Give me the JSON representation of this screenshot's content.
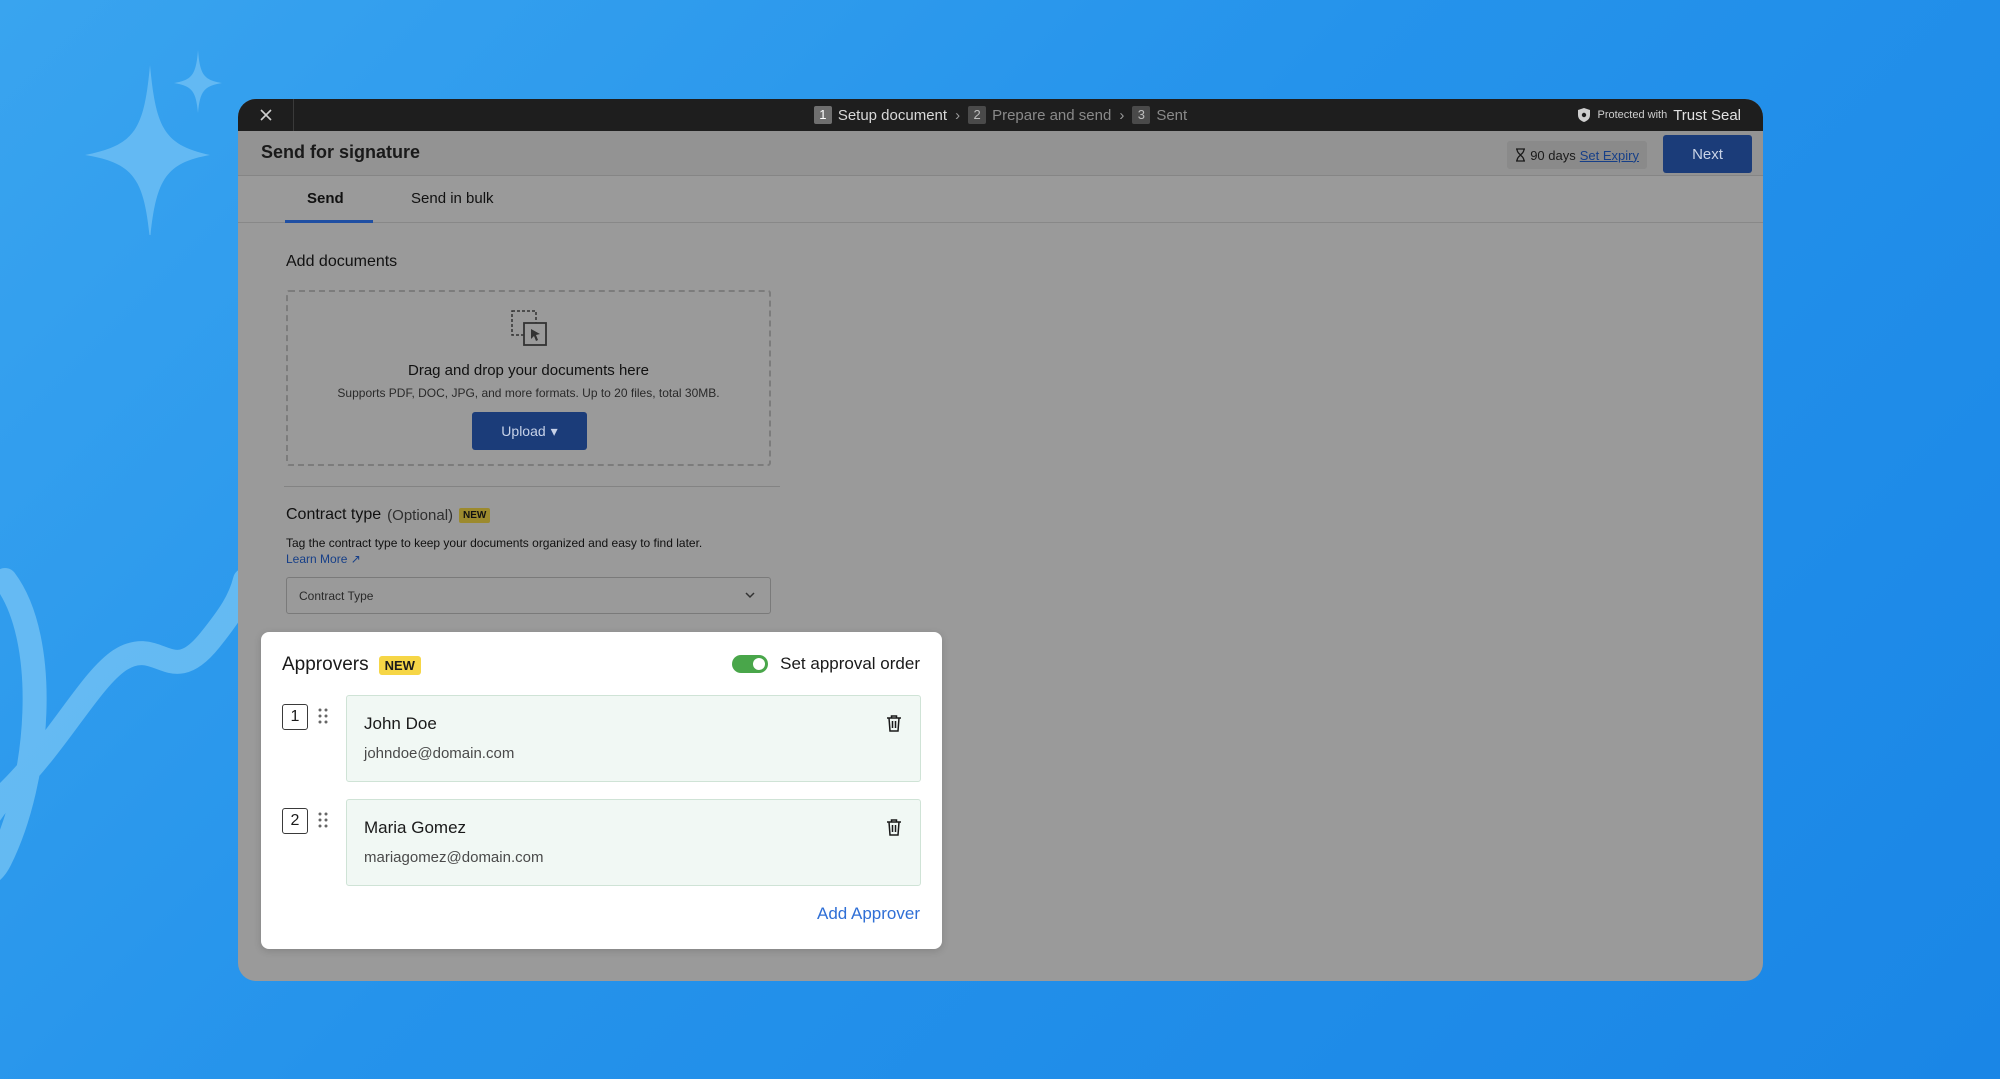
{
  "stepper": {
    "steps": [
      {
        "num": "1",
        "label": "Setup document"
      },
      {
        "num": "2",
        "label": "Prepare and send"
      },
      {
        "num": "3",
        "label": "Sent"
      }
    ],
    "protected_prefix": "Protected with",
    "protected_brand": "Trust Seal"
  },
  "header": {
    "title": "Send for signature",
    "expiry_days": "90 days",
    "set_expiry": "Set Expiry",
    "next_label": "Next"
  },
  "tabs": [
    {
      "label": "Send"
    },
    {
      "label": "Send in bulk"
    }
  ],
  "add_documents": {
    "title": "Add documents",
    "drop_title": "Drag and drop your documents here",
    "drop_subtitle": "Supports PDF, DOC, JPG, and more formats. Up to 20 files, total 30MB.",
    "upload_label": "Upload"
  },
  "contract_type": {
    "title": "Contract type",
    "optional": "(Optional)",
    "badge": "NEW",
    "description": "Tag the contract type to keep your documents organized and easy to find later.",
    "learn_more": "Learn More",
    "placeholder": "Contract Type"
  },
  "approvers": {
    "title": "Approvers",
    "badge": "NEW",
    "order_label": "Set approval order",
    "order_enabled": true,
    "items": [
      {
        "order": "1",
        "name": "John Doe",
        "email": "johndoe@domain.com"
      },
      {
        "order": "2",
        "name": "Maria Gomez",
        "email": "mariagomez@domain.com"
      }
    ],
    "add_label": "Add Approver"
  },
  "colors": {
    "primary_button": "#1b3c79",
    "toggle_on": "#49a64a",
    "new_badge": "#f6d646",
    "link": "#2f6fd6"
  }
}
